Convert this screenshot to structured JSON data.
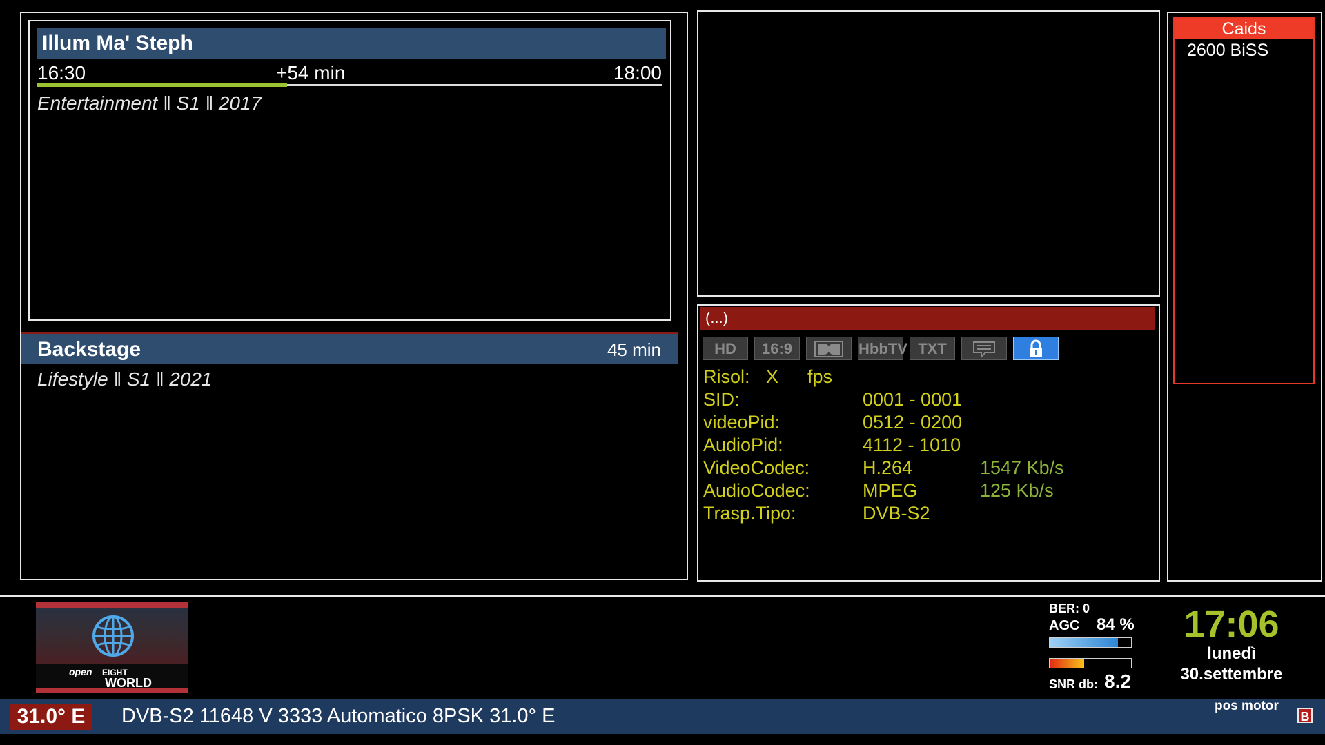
{
  "now": {
    "title": "Illum Ma' Steph",
    "start": "16:30",
    "remaining": "+54 min",
    "end": "18:00",
    "progress": 0.4,
    "info": "Entertainment ‖ S1 ‖ 2017"
  },
  "next": {
    "title": "Backstage",
    "duration": "45 min",
    "info": "Lifestyle ‖ S1 ‖ 2021"
  },
  "info_panel": {
    "header": "(...)",
    "badges": [
      "HD",
      "16:9",
      "",
      "HbbTV",
      "TXT",
      "",
      ""
    ],
    "badge_icons": [
      "",
      "",
      "dolby-icon",
      "",
      "",
      "subtitles-icon",
      "lock-icon"
    ],
    "risol_label": "Risol:",
    "risol_x": "X",
    "risol_fps": "fps",
    "rows": [
      {
        "label": "SID:",
        "value": "0001 - 0001",
        "rate": ""
      },
      {
        "label": "videoPid:",
        "value": "0512 - 0200",
        "rate": ""
      },
      {
        "label": "AudioPid:",
        "value": "4112 - 1010",
        "rate": ""
      },
      {
        "label": "VideoCodec:",
        "value": "H.264",
        "rate": "1547 Kb/s"
      },
      {
        "label": "AudioCodec:",
        "value": "MPEG",
        "rate": "125 Kb/s"
      },
      {
        "label": "Trasp.Tipo:",
        "value": "DVB-S2",
        "rate": ""
      }
    ]
  },
  "caids": {
    "header": "Caids",
    "items": [
      "2600 BiSS"
    ]
  },
  "signal": {
    "ber_label": "BER:",
    "ber_value": "0",
    "agc_label": "AGC",
    "agc_value": "84 %",
    "agc_level": 0.84,
    "snr_label": "SNR db:",
    "snr_value": "8.2",
    "snr_level": 0.42
  },
  "clock": {
    "time": "17:06",
    "day": "lunedì",
    "date": "30.settembre"
  },
  "logo": {
    "text_open": "open",
    "text_eight": "EIGHT",
    "text_world": "WORLD"
  },
  "satellite": {
    "position": "31.0° E",
    "transponder": "DVB-S2 11648 V 3333 Automatico 8PSK 31.0° E",
    "motor": "pos motor",
    "marker": "B"
  },
  "colors": {
    "panel_blue": "#2f4d6f",
    "info_red": "#8c1a12",
    "caids_red": "#ee3b27",
    "info_yellow": "#cfcf1c",
    "info_green": "#8eb33a",
    "clock_green": "#a6c22a",
    "progress_green": "#9bc230",
    "lock_blue": "#2f7fe0"
  }
}
